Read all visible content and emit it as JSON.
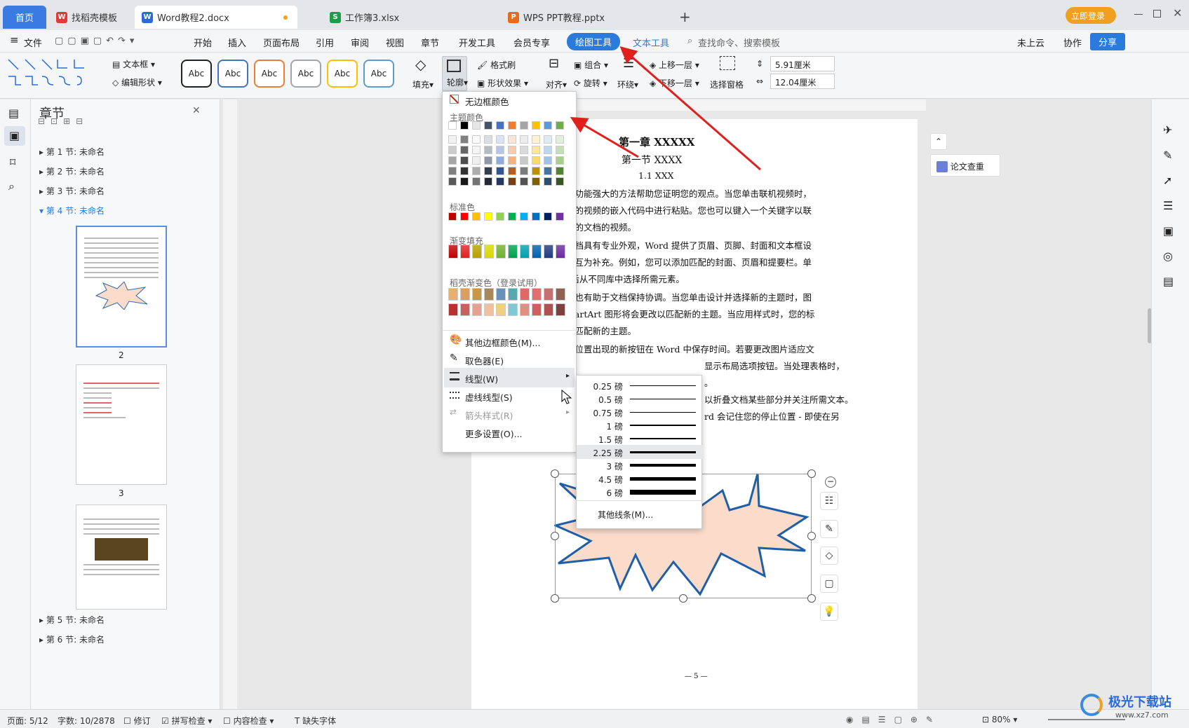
{
  "tabs": {
    "home": "首页",
    "t1": "找稻壳模板",
    "t2": "Word教程2.docx",
    "t3": "工作簿3.xlsx",
    "t4": "WPS PPT教程.pptx",
    "add": "+"
  },
  "topright": {
    "login": "立即登录"
  },
  "menu": {
    "file": "文件",
    "items": [
      "开始",
      "插入",
      "页面布局",
      "引用",
      "审阅",
      "视图",
      "章节",
      "开发工具",
      "会员专享"
    ],
    "draw": "绘图工具",
    "text": "文本工具",
    "search": "查找命令、搜索模板",
    "cloud": "未上云",
    "collab": "协作",
    "share": "分享"
  },
  "ribbon": {
    "textbox": "文本框",
    "editshape": "编辑形状",
    "abc": [
      "Abc",
      "Abc",
      "Abc",
      "Abc",
      "Abc",
      "Abc"
    ],
    "fill": "填充",
    "outline": "轮廓",
    "formatpainter": "格式刷",
    "shapeeffect": "形状效果",
    "align": "对齐",
    "group": "组合",
    "rotate": "旋转",
    "wrap": "环绕",
    "up": "上移一层",
    "down": "下移一层",
    "selpane": "选择窗格",
    "h": "5.91厘米",
    "w": "12.04厘米"
  },
  "panel": {
    "title": "章节",
    "sections": [
      "第 1 节: 未命名",
      "第 2 节: 未命名",
      "第 3 节: 未命名",
      "第 4 节: 未命名",
      "第 5 节: 未命名",
      "第 6 节: 未命名"
    ],
    "p2": "2",
    "p3": "3"
  },
  "doc": {
    "h1": "第一章 XXXXX",
    "h2": "第一节 XXXX",
    "h3": "1.1 XXX",
    "lines": [
      "提供了功能强大的方法帮助您证明您的观点。当您单击联机视频时，",
      "要添加的视频的嵌入代码中进行粘贴。您也可以键入一个关键字以联",
      "适合您的文档的视频。",
      "您的文档具有专业外观，Word 提供了页眉、页脚、封面和文本框设",
      "设计可互为补充。例如，您可以添加匹配的封面、页眉和提要栏。单",
      "”，然后从不同库中选择所需元素。",
      "和样式也有助于文档保持协调。当您单击设计并选择新的主题时，图",
      "或 SmartArt 图形将会更改以匹配新的主题。当应用样式时，您的标",
      "更改以匹配新的主题。",
      "在需要位置出现的新按钮在 Word 中保存时间。若要更改图片适应文",
      "显示布局选项按钮。当处理表格时，",
      "。",
      "以折叠文档某些部分并关注所需文本。",
      "rd 会记住您的停止位置 - 即使在另"
    ],
    "pageno": "— 5 —"
  },
  "dropdown": {
    "none": "无边框颜色",
    "theme": "主题颜色",
    "standard": "标准色",
    "gradient": "渐变填充",
    "daoke": "稻壳渐变色（登录试用）",
    "more": "其他边框颜色(M)...",
    "picker": "取色器(E)",
    "linetype": "线型(W)",
    "dash": "虚线线型(S)",
    "arrow": "箭头样式(R)",
    "settings": "更多设置(O)..."
  },
  "theme_row": [
    "#ffffff",
    "#000000",
    "#e7e6e6",
    "#44546a",
    "#4472c4",
    "#ed7d31",
    "#a5a5a5",
    "#ffc000",
    "#5b9bd5",
    "#70ad47"
  ],
  "standard_colors": [
    "#c00000",
    "#ff0000",
    "#ffc000",
    "#ffff00",
    "#92d050",
    "#00b050",
    "#00b0f0",
    "#0070c0",
    "#002060",
    "#7030a0"
  ],
  "gradient_colors": [
    "#c00000",
    "#e02020",
    "#b8a000",
    "#d8d800",
    "#70b030",
    "#00a050",
    "#00a0b0",
    "#0060b0",
    "#1f3a80",
    "#6a2aa0"
  ],
  "daoke1": [
    "#e8b070",
    "#d8a060",
    "#c89848",
    "#a88858",
    "#6890b8",
    "#58a8b0",
    "#e06868",
    "#e07070",
    "#c87070",
    "#906050"
  ],
  "daoke2": [
    "#b83030",
    "#c86060",
    "#e8a090",
    "#f0c0a0",
    "#f0d080",
    "#80c8d8",
    "#e09080",
    "#d06060",
    "#b05050",
    "#804040"
  ],
  "submenu": {
    "weights": [
      "0.25 磅",
      "0.5 磅",
      "0.75 磅",
      "1 磅",
      "1.5 磅",
      "2.25 磅",
      "3 磅",
      "4.5 磅",
      "6 磅"
    ],
    "other": "其他线条(M)..."
  },
  "rightpanel": {
    "paper": "论文查重"
  },
  "status": {
    "page": "页面: 5/12",
    "words": "字数: 10/2878",
    "revise": "修订",
    "spell": "拼写检查",
    "content": "内容检查",
    "font": "缺失字体",
    "zoom": "80%"
  },
  "watermark": "极光下载站",
  "watermark_url": "www.xz7.com"
}
